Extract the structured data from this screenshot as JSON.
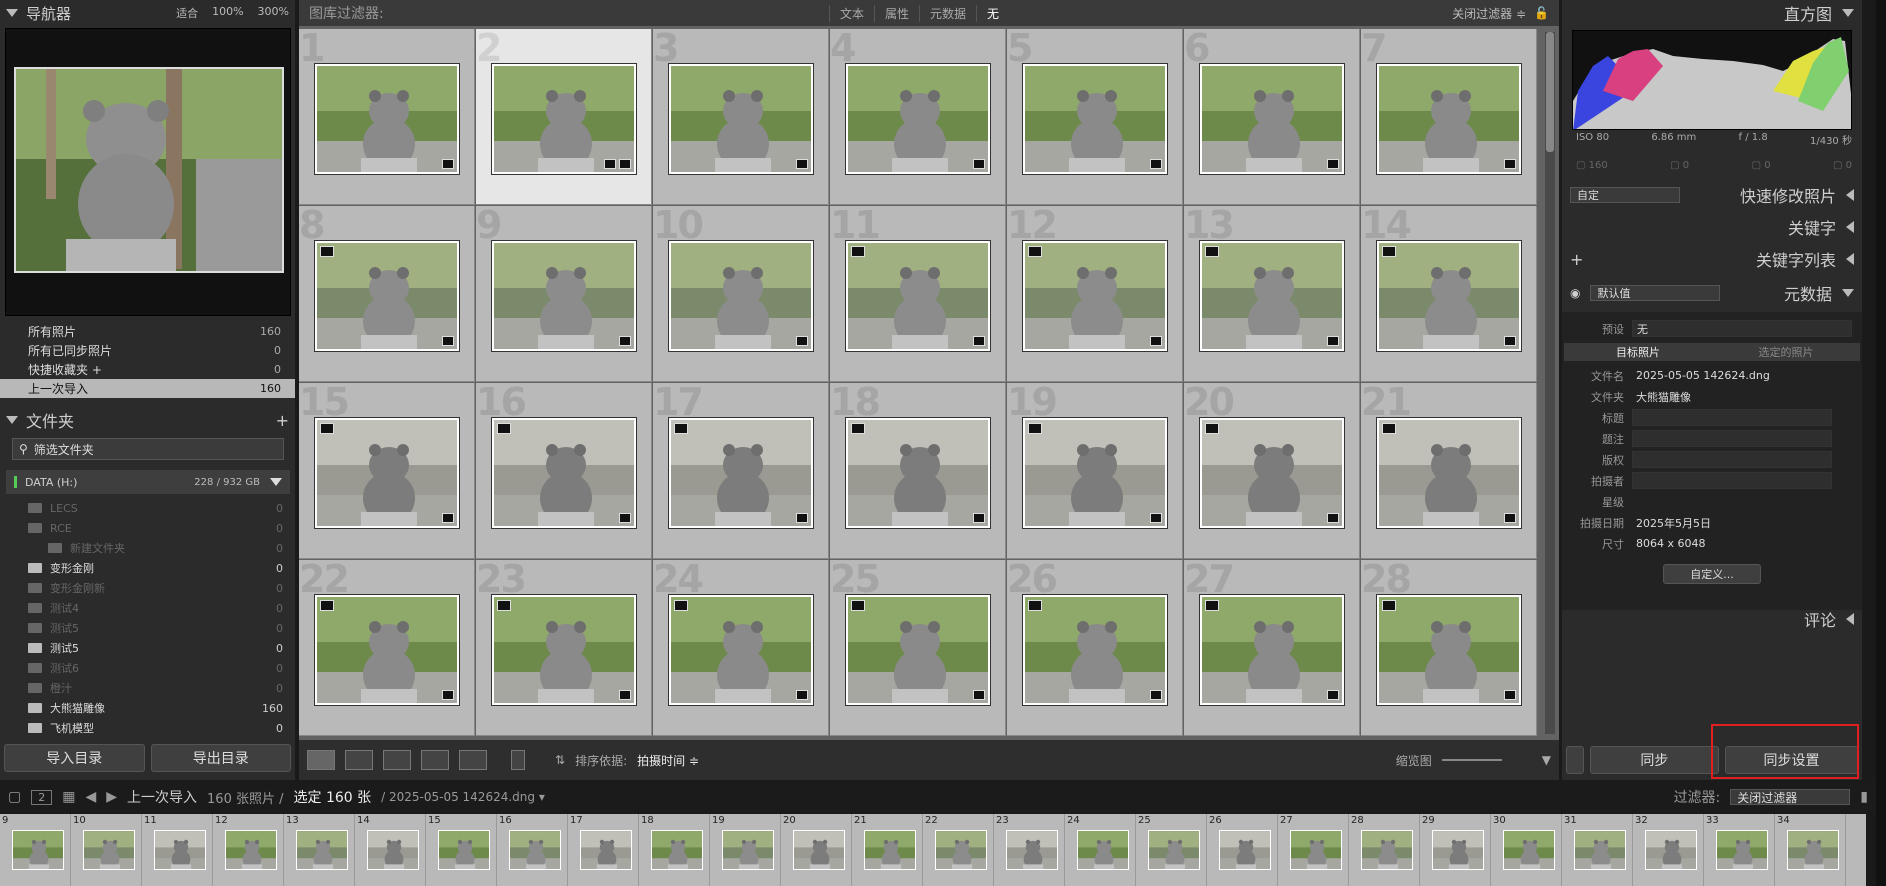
{
  "navigator": {
    "title": "导航器",
    "options": [
      "适合",
      "100%",
      "300%"
    ]
  },
  "collections": [
    {
      "label": "所有照片",
      "count": "160"
    },
    {
      "label": "所有已同步照片",
      "count": "0"
    },
    {
      "label": "快捷收藏夹 +",
      "count": "0"
    },
    {
      "label": "上一次导入",
      "count": "160",
      "selected": true
    }
  ],
  "folders": {
    "title": "文件夹",
    "filter_placeholder": "筛选文件夹",
    "volume": "DATA (H:)",
    "volume_size": "228 / 932 GB",
    "items": [
      {
        "label": "LECS",
        "count": "0",
        "on": false
      },
      {
        "label": "RCE",
        "count": "0",
        "on": false
      },
      {
        "label": "新建文件夹",
        "count": "0",
        "on": false
      },
      {
        "label": "变形金刚",
        "count": "0",
        "on": true
      },
      {
        "label": "变形金刚新",
        "count": "0",
        "on": false
      },
      {
        "label": "测试4",
        "count": "0",
        "on": false
      },
      {
        "label": "测试5",
        "count": "0",
        "on": false
      },
      {
        "label": "测试5",
        "count": "0",
        "on": true
      },
      {
        "label": "测试6",
        "count": "0",
        "on": false
      },
      {
        "label": "橙汁",
        "count": "0",
        "on": false
      },
      {
        "label": "大熊猫雕像",
        "count": "160",
        "on": true
      },
      {
        "label": "飞机模型",
        "count": "0",
        "on": true
      }
    ]
  },
  "left_buttons": {
    "import": "导入目录",
    "export": "导出目录"
  },
  "filter_bar": {
    "title": "图库过滤器:",
    "tabs": [
      "文本",
      "属性",
      "元数据",
      "无"
    ],
    "selected": "无",
    "right": "关闭过滤器 ≑"
  },
  "grid": {
    "selected": 2
  },
  "toolbar": {
    "sort_label": "排序依据:",
    "sort_value": "拍摄时间 ≑",
    "zoom_label": "缩览图"
  },
  "histogram": {
    "title": "直方图",
    "iso": "ISO 80",
    "focal": "6.86 mm",
    "aperture": "f / 1.8",
    "shutter": "1/430 秒",
    "count": "160"
  },
  "quick_develop": {
    "preset": "自定",
    "title": "快速修改照片"
  },
  "keywords": {
    "title": "关键字",
    "list_title": "关键字列表"
  },
  "metadata": {
    "preset": "默认值",
    "title": "元数据",
    "preset_label": "预设",
    "preset_value": "无",
    "tab_target": "目标照片",
    "tab_selected": "选定的照片",
    "rows": [
      {
        "k": "文件名",
        "v": "2025-05-05 142624.dng",
        "box": false
      },
      {
        "k": "文件夹",
        "v": "大熊猫雕像",
        "box": false
      },
      {
        "k": "标题",
        "v": "",
        "box": true
      },
      {
        "k": "题注",
        "v": "",
        "box": true
      },
      {
        "k": "版权",
        "v": "",
        "box": true
      },
      {
        "k": "拍摄者",
        "v": "",
        "box": true
      },
      {
        "k": "星级",
        "v": "",
        "box": false
      },
      {
        "k": "拍摄日期",
        "v": "2025年5月5日",
        "box": false
      },
      {
        "k": "尺寸",
        "v": "8064 x 6048",
        "box": false
      }
    ],
    "custom_button": "自定义..."
  },
  "comments": {
    "title": "评论"
  },
  "right_buttons": {
    "sync": "同步",
    "sync_settings": "同步设置"
  },
  "status": {
    "page": "2",
    "source": "上一次导入",
    "photos": "160 张照片 /",
    "selected": "选定 160 张",
    "file": "/ 2025-05-05 142624.dng ▾",
    "filter_label": "过滤器:",
    "filter_value": "关闭过滤器"
  },
  "filmstrip": {
    "start": 9,
    "end": 34
  }
}
